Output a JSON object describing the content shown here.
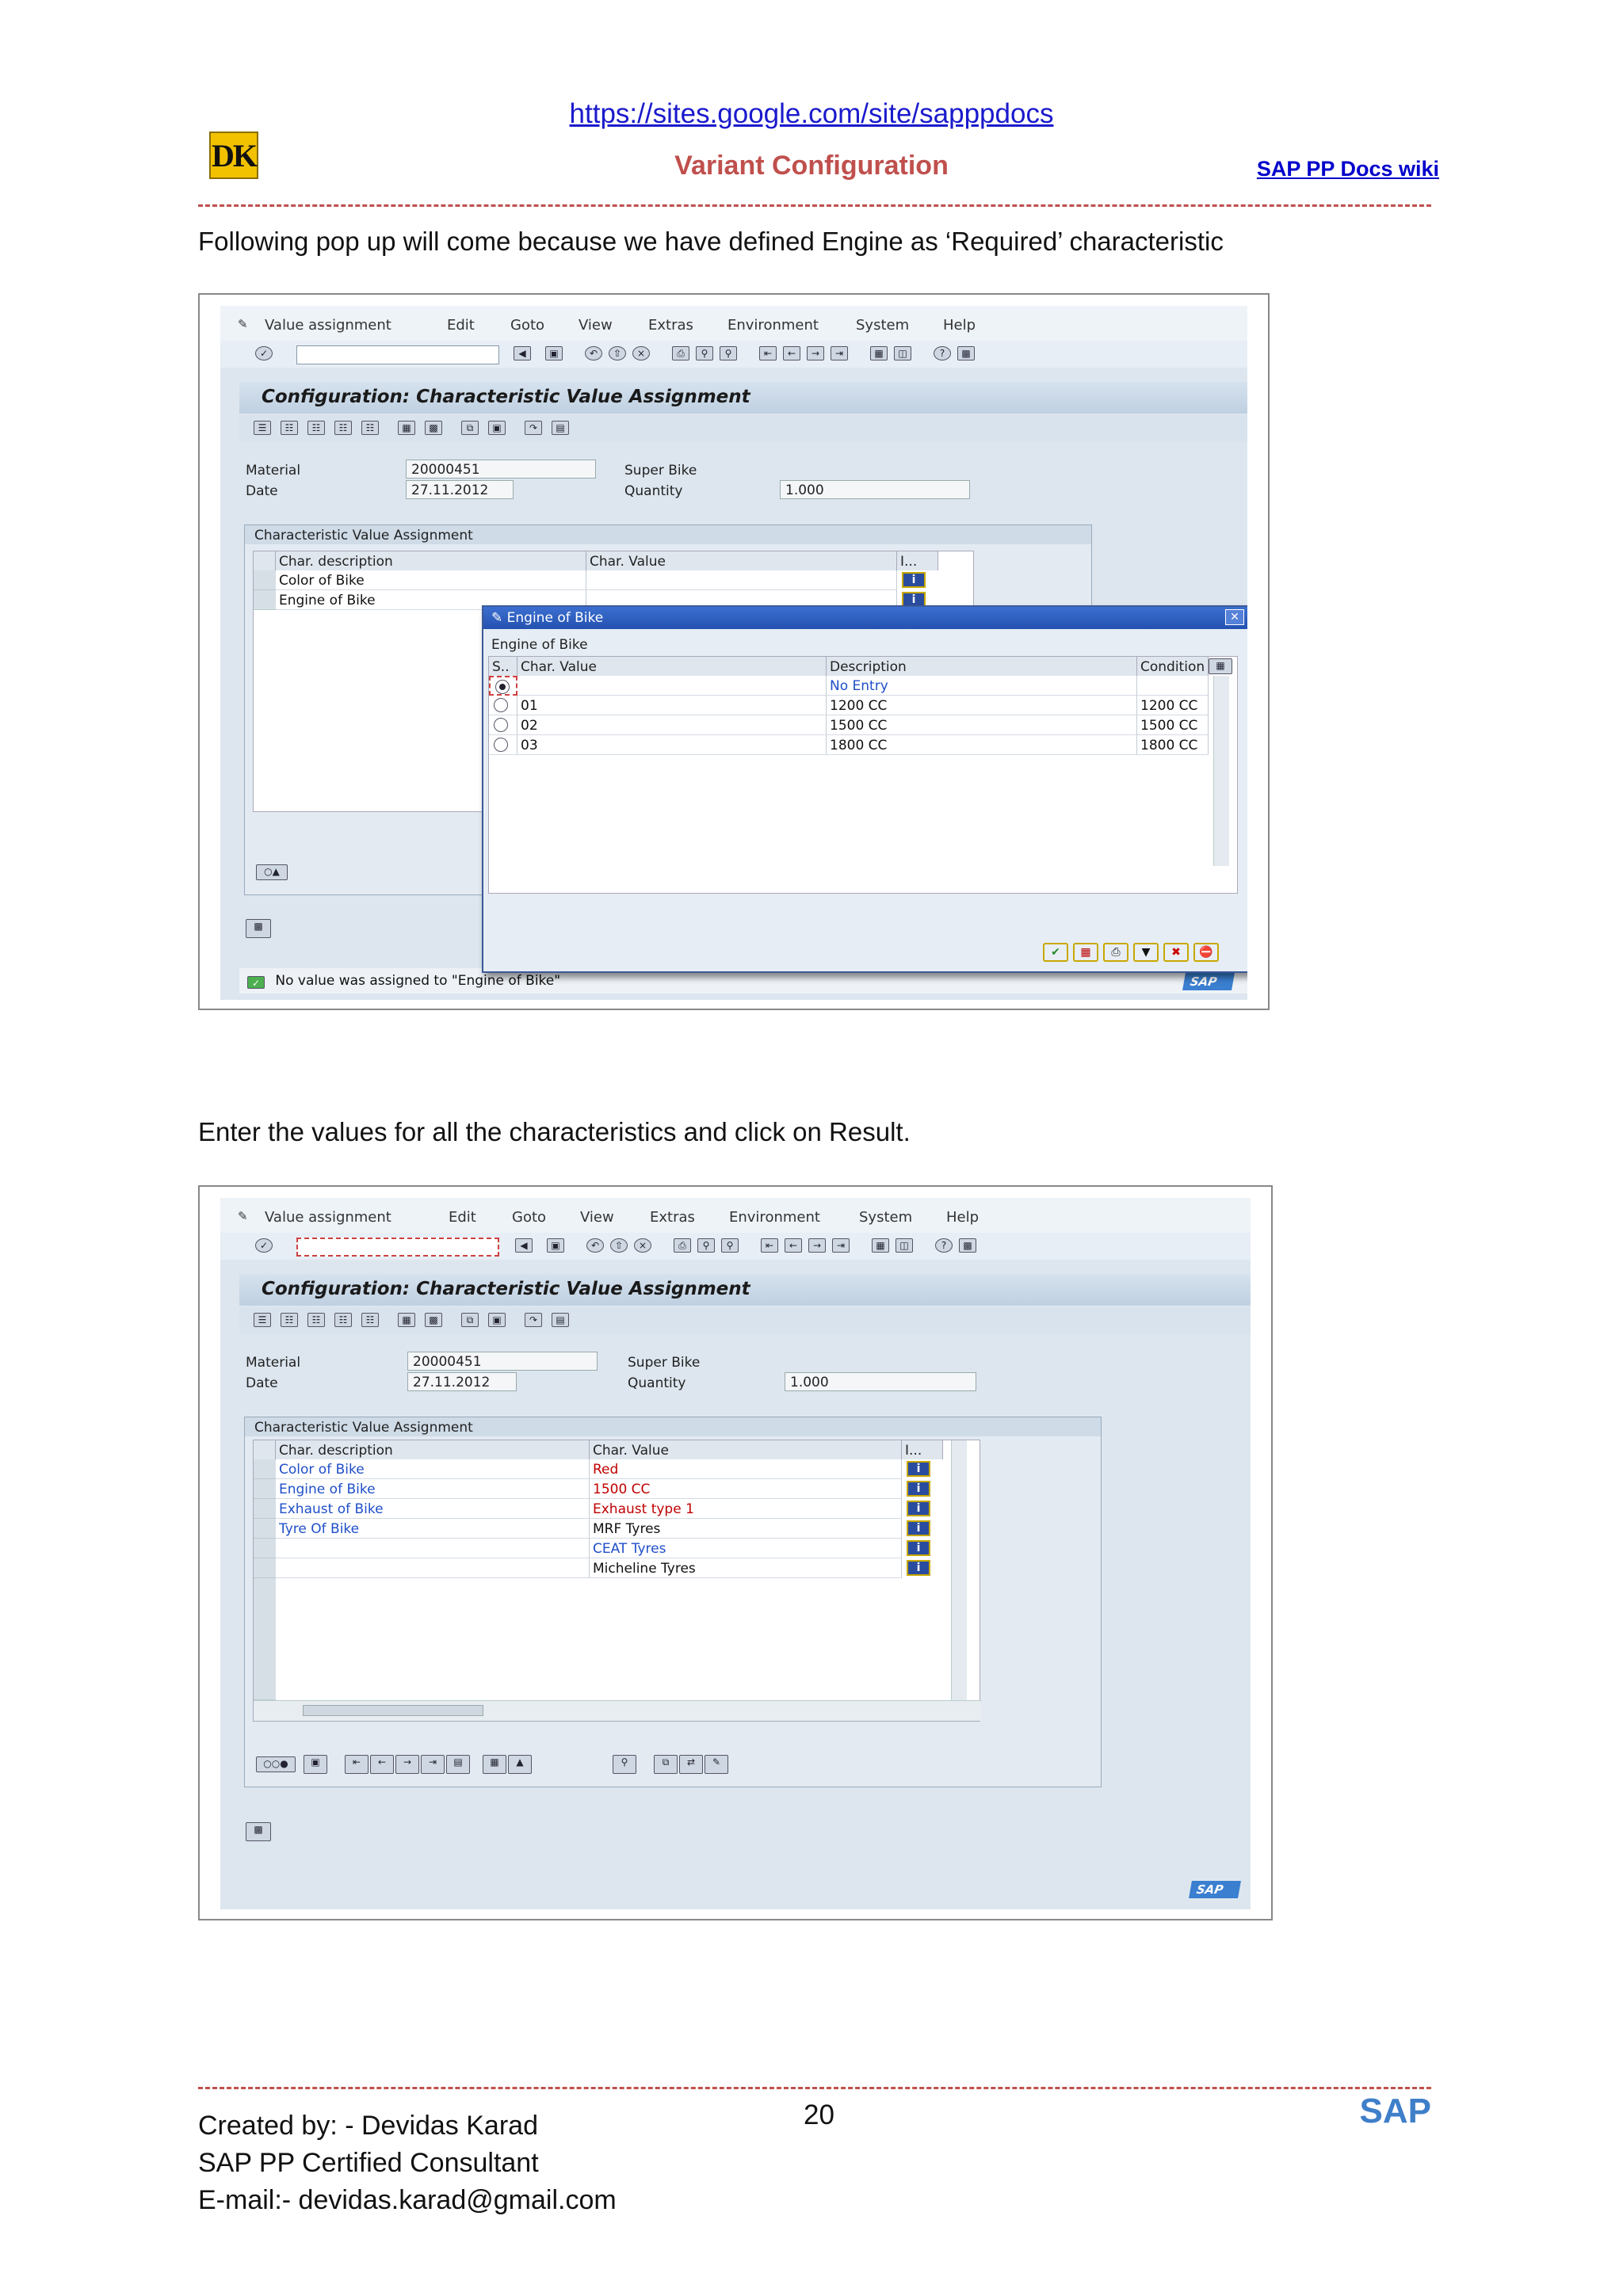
{
  "header": {
    "logo": "DK",
    "url": "https://sites.google.com/site/sapppdocs",
    "title": "Variant Configuration",
    "wiki": "SAP PP Docs wiki"
  },
  "para1": "Following pop up will come because we have defined Engine as ‘Required’ characteristic",
  "para2": "Enter the values for all the characteristics and click on Result.",
  "sap": {
    "menu": [
      "Value assignment",
      "Edit",
      "Goto",
      "View",
      "Extras",
      "Environment",
      "System",
      "Help"
    ],
    "screen_title": "Configuration: Characteristic Value Assignment",
    "material_label": "Material",
    "material_value": "20000451",
    "material_desc": "Super Bike",
    "date_label": "Date",
    "date_value": "27.11.2012",
    "quantity_label": "Quantity",
    "quantity_value": "1.000",
    "group_title": "Characteristic Value Assignment",
    "col_desc": "Char. description",
    "col_value": "Char. Value",
    "col_info": "I...",
    "status_msg": "No value was assigned to \"Engine of Bike\"",
    "brand": "SAP"
  },
  "screen1": {
    "rows": [
      {
        "desc": "Color of Bike",
        "value": ""
      },
      {
        "desc": "Engine of Bike",
        "value": ""
      }
    ]
  },
  "popup": {
    "title": "Engine of Bike",
    "subtitle": "Engine of Bike",
    "cols": [
      "S..",
      "Char. Value",
      "Description",
      "Condition"
    ],
    "rows": [
      {
        "value": "",
        "desc": "No Entry",
        "cond": ""
      },
      {
        "value": "01",
        "desc": "1200 CC",
        "cond": "1200 CC"
      },
      {
        "value": "02",
        "desc": "1500 CC",
        "cond": "1500 CC"
      },
      {
        "value": "03",
        "desc": "1800 CC",
        "cond": "1800 CC"
      }
    ]
  },
  "screen2": {
    "rows": [
      {
        "desc": "Color of Bike",
        "value": "Red"
      },
      {
        "desc": "Engine of Bike",
        "value": "1500 CC"
      },
      {
        "desc": "Exhaust of Bike",
        "value": "Exhaust type 1"
      },
      {
        "desc": "Tyre Of Bike",
        "value": "MRF Tyres"
      },
      {
        "desc": "",
        "value": "CEAT Tyres"
      },
      {
        "desc": "",
        "value": "Micheline Tyres"
      }
    ]
  },
  "footer": {
    "created": "Created by: - Devidas Karad",
    "role": "SAP PP Certified Consultant",
    "email": "E-mail:- devidas.karad@gmail.com",
    "page": "20",
    "brand": "SAP"
  }
}
